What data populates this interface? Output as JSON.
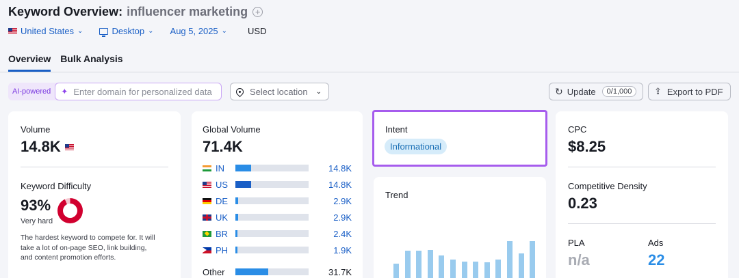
{
  "header": {
    "title_prefix": "Keyword Overview:",
    "keyword": "influencer marketing",
    "filters": {
      "country": "United States",
      "device": "Desktop",
      "date": "Aug 5, 2025",
      "currency": "USD"
    },
    "tabs": [
      {
        "label": "Overview",
        "active": true
      },
      {
        "label": "Bulk Analysis",
        "active": false
      }
    ]
  },
  "toolbar": {
    "ai_label": "AI-powered",
    "domain_placeholder": "Enter domain for personalized data",
    "location_placeholder": "Select location",
    "update_label": "Update",
    "update_count": "0/1,000",
    "export_label": "Export to PDF"
  },
  "volume_card": {
    "label": "Volume",
    "value": "14.8K",
    "kd_label": "Keyword Difficulty",
    "kd_value": "93%",
    "kd_percent": 93,
    "kd_level": "Very hard",
    "kd_description_lines": [
      "The hardest keyword to compete for. It will",
      "take a lot of on-page SEO, link building,",
      "and content promotion efforts."
    ]
  },
  "global_card": {
    "label": "Global Volume",
    "value": "71.4K",
    "countries": [
      {
        "code": "IN",
        "value": "14.8K",
        "share": 0.21
      },
      {
        "code": "US",
        "value": "14.8K",
        "share": 0.21
      },
      {
        "code": "DE",
        "value": "2.9K",
        "share": 0.04
      },
      {
        "code": "UK",
        "value": "2.9K",
        "share": 0.04
      },
      {
        "code": "BR",
        "value": "2.4K",
        "share": 0.03
      },
      {
        "code": "PH",
        "value": "1.9K",
        "share": 0.03
      },
      {
        "code": "Other",
        "value": "31.7K",
        "share": 0.44
      }
    ]
  },
  "intent_card": {
    "label": "Intent",
    "badge": "Informational"
  },
  "trend_card": {
    "label": "Trend",
    "bars": [
      0.57,
      0.9,
      0.9,
      0.92,
      0.77,
      0.68,
      0.62,
      0.62,
      0.6,
      0.67,
      1.13,
      0.83,
      1.13
    ]
  },
  "cpc_card": {
    "label": "CPC",
    "value": "$8.25",
    "density_label": "Competitive Density",
    "density_value": "0.23",
    "pla_label": "PLA",
    "pla_value": "n/a",
    "ads_label": "Ads",
    "ads_value": "22"
  },
  "colors": {
    "accent": "#1a5fc6",
    "bar_fill": "#2a8de6",
    "trend_bar": "#99cbee",
    "kd_red": "#d1002f",
    "intent_outline": "#a65ced"
  }
}
